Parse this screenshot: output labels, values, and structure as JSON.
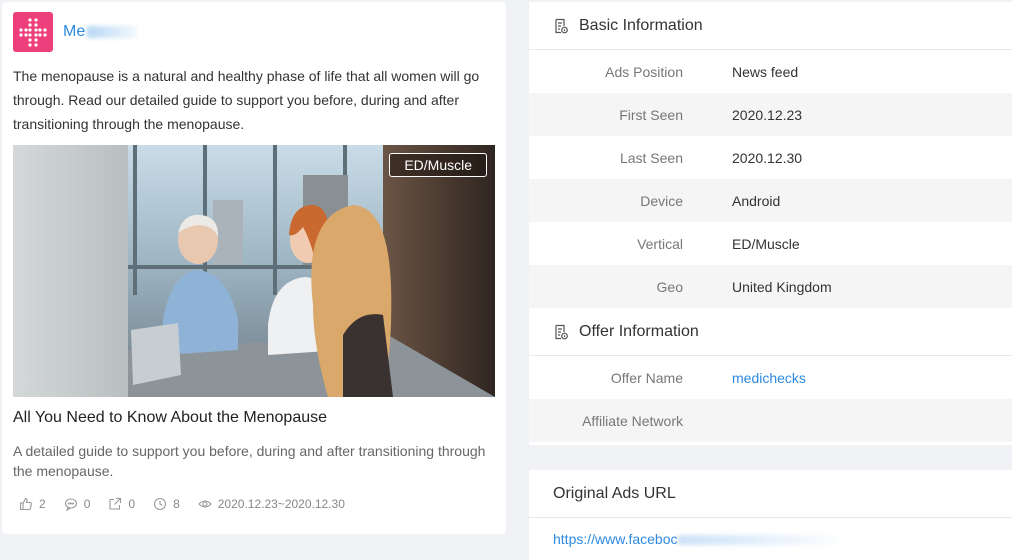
{
  "ad": {
    "advertiser_name": "Me",
    "body_text": "The menopause is a natural and healthy phase of life that all women will go through. Read our detailed guide to support you before, during and after transitioning through the menopause.",
    "image_tag": "ED/Muscle",
    "headline": "All You Need to Know About the Menopause",
    "description": "A detailed guide to support you before, during and after transitioning through the menopause.",
    "stats": {
      "likes": "2",
      "comments": "0",
      "shares": "0",
      "days": "8",
      "date_range": "2020.12.23~2020.12.30"
    },
    "colors": {
      "logo_bg": "#ec3f7c",
      "link": "#2d8ae0"
    }
  },
  "basic_info": {
    "title": "Basic Information",
    "rows": [
      {
        "label": "Ads Position",
        "value": "News feed"
      },
      {
        "label": "First Seen",
        "value": "2020.12.23"
      },
      {
        "label": "Last Seen",
        "value": "2020.12.30"
      },
      {
        "label": "Device",
        "value": "Android"
      },
      {
        "label": "Vertical",
        "value": "ED/Muscle"
      },
      {
        "label": "Geo",
        "value": "United Kingdom"
      }
    ]
  },
  "offer_info": {
    "title": "Offer Information",
    "rows": [
      {
        "label": "Offer Name",
        "value": "medichecks"
      },
      {
        "label": "Affiliate Network",
        "value": ""
      }
    ]
  },
  "original_url": {
    "title": "Original Ads URL",
    "url": "https://www.faceboc"
  }
}
